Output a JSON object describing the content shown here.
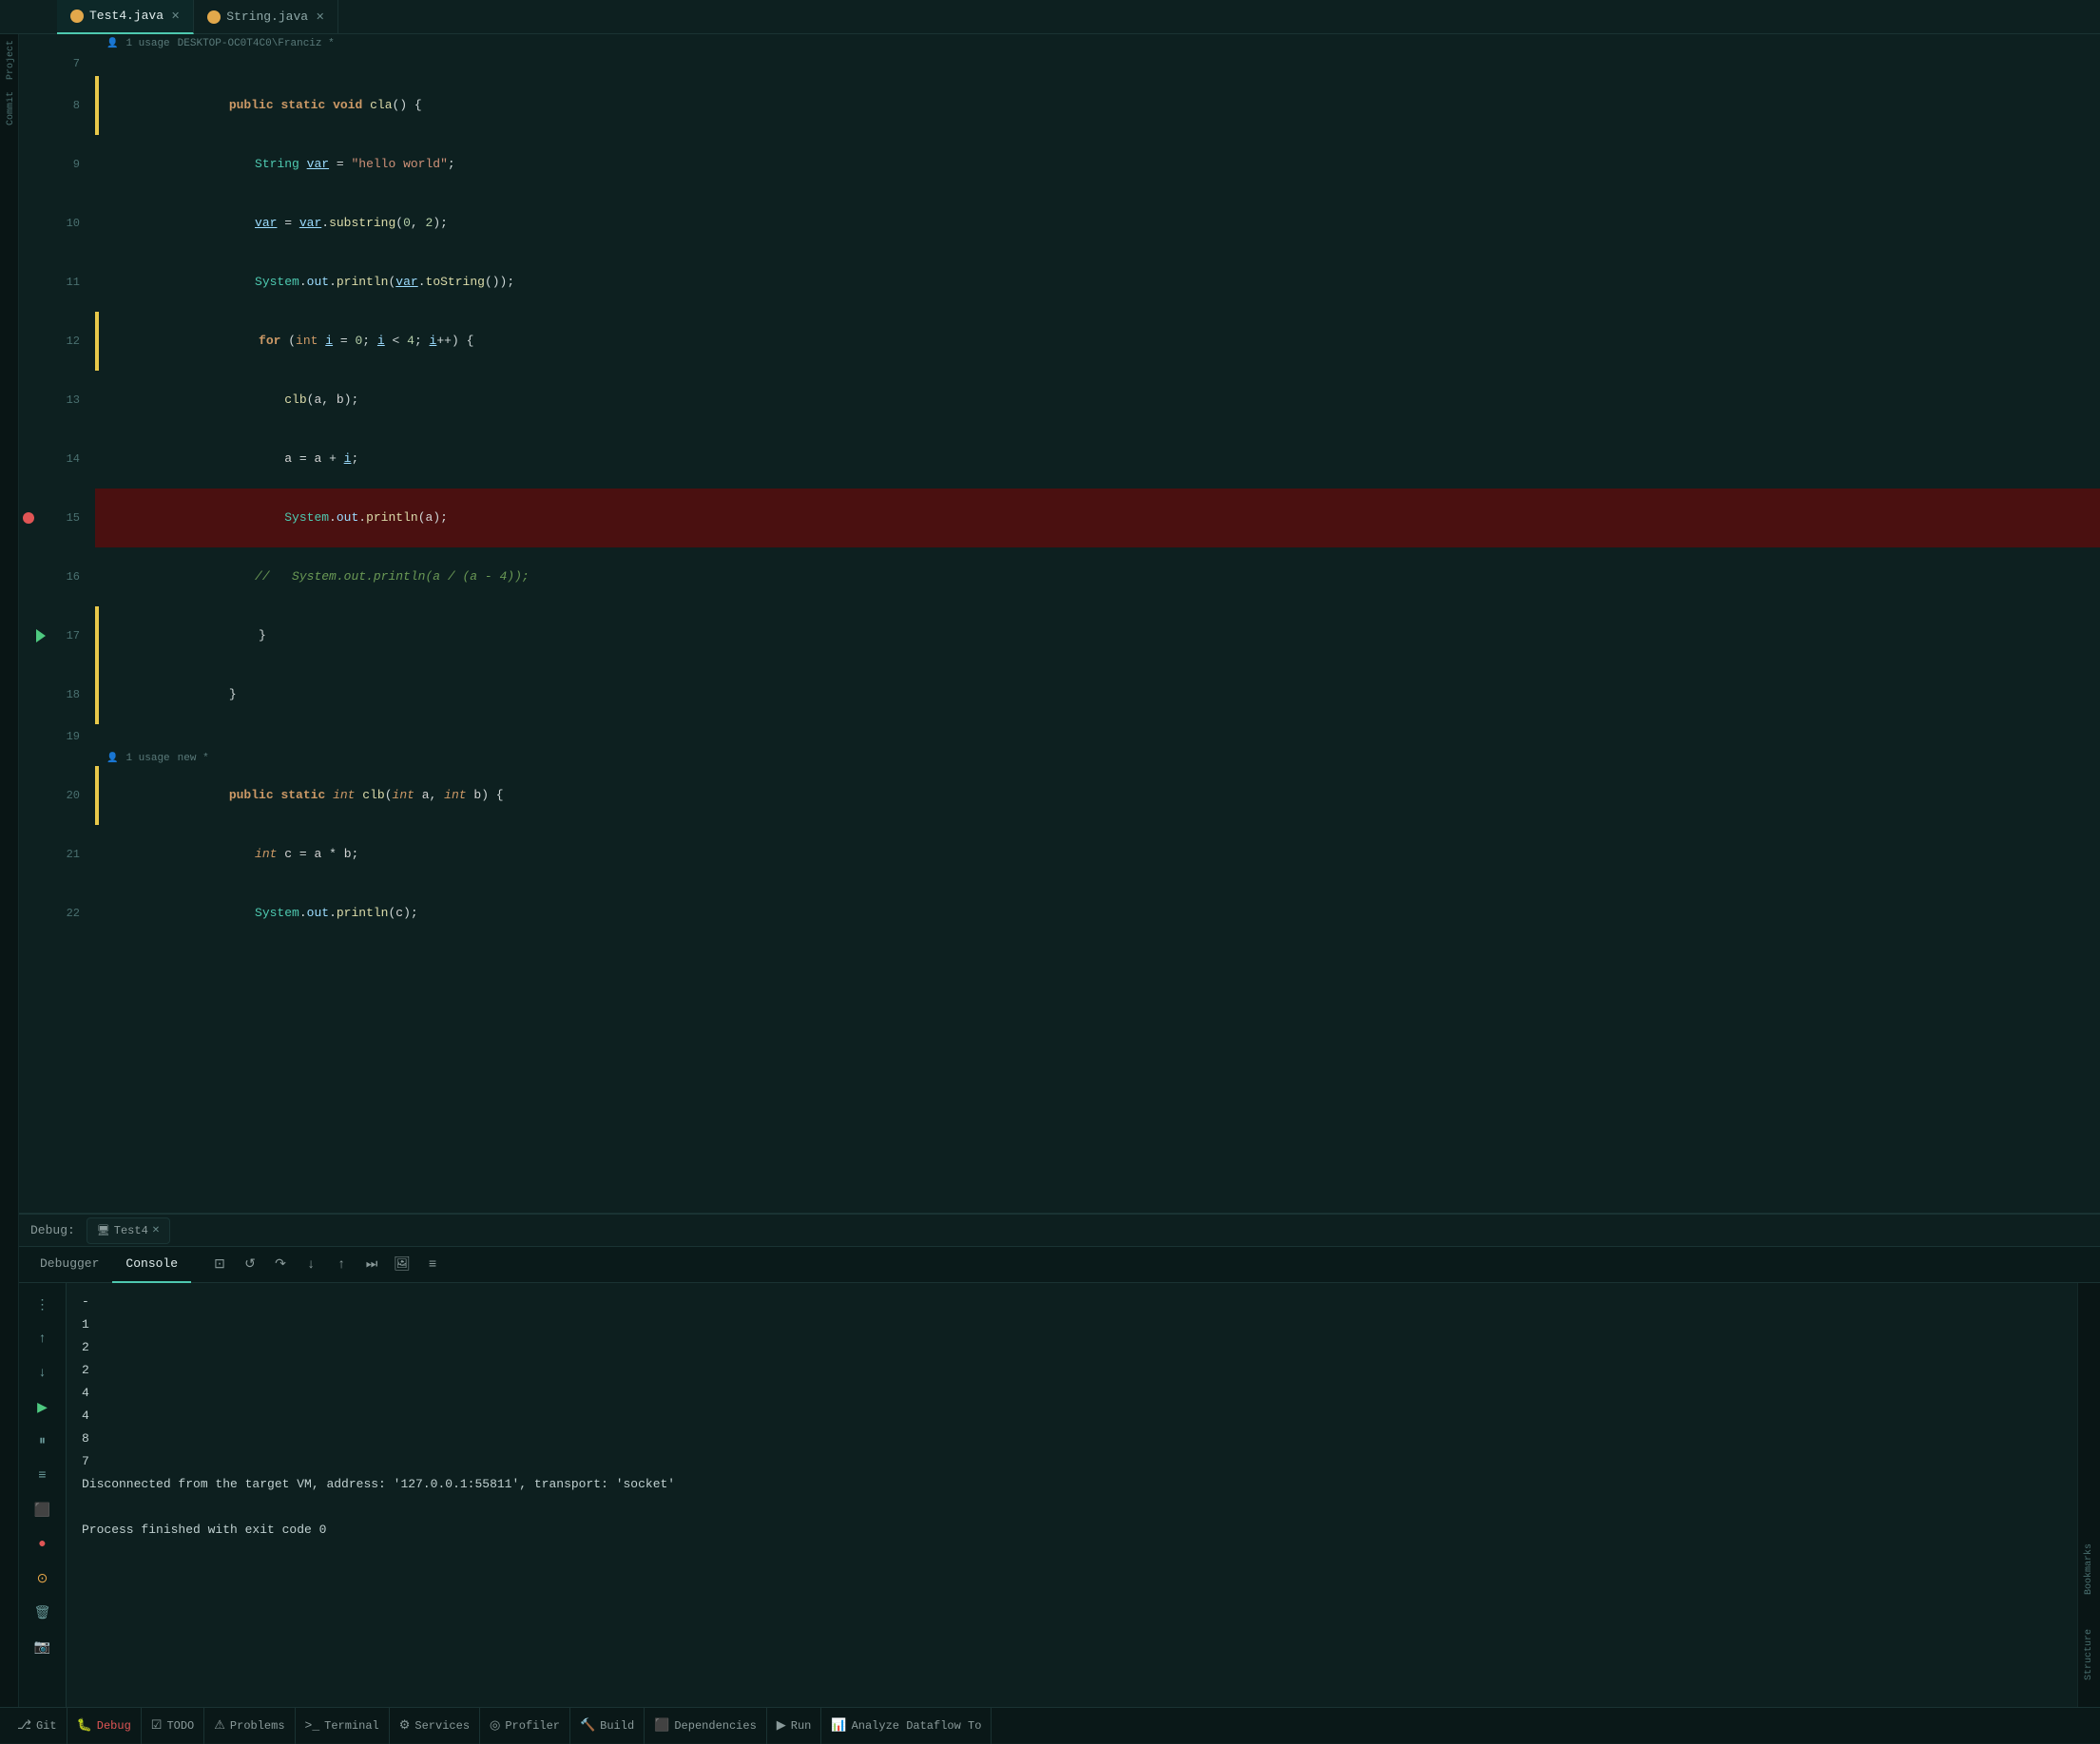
{
  "tabs": [
    {
      "id": "test4",
      "label": "Test4.java",
      "active": true,
      "modified": false
    },
    {
      "id": "string",
      "label": "String.java",
      "active": false,
      "modified": false
    }
  ],
  "editor": {
    "usage_hint_1": "1 usage",
    "usage_user_1": "DESKTOP-OC0T4C0\\Franciz *",
    "usage_hint_2": "1 usage",
    "usage_user_2": "new *",
    "lines": [
      {
        "num": "7",
        "text": "",
        "bar": false,
        "breakpoint": false,
        "debugArrow": false,
        "highlighted": false
      },
      {
        "num": "8",
        "text": "    public static void cla() {",
        "bar": true,
        "breakpoint": false,
        "debugArrow": false,
        "highlighted": false
      },
      {
        "num": "9",
        "text": "        String var = \"hello world\";",
        "bar": false,
        "breakpoint": false,
        "debugArrow": false,
        "highlighted": false
      },
      {
        "num": "10",
        "text": "        var = var.substring(0, 2);",
        "bar": false,
        "breakpoint": false,
        "debugArrow": false,
        "highlighted": false
      },
      {
        "num": "11",
        "text": "        System.out.println(var.toString());",
        "bar": false,
        "breakpoint": false,
        "debugArrow": false,
        "highlighted": false
      },
      {
        "num": "12",
        "text": "        for (int i = 0; i < 4; i++) {",
        "bar": true,
        "breakpoint": false,
        "debugArrow": false,
        "highlighted": false
      },
      {
        "num": "13",
        "text": "            clb(a, b);",
        "bar": false,
        "breakpoint": false,
        "debugArrow": false,
        "highlighted": false
      },
      {
        "num": "14",
        "text": "            a = a + i;",
        "bar": false,
        "breakpoint": false,
        "debugArrow": false,
        "highlighted": false
      },
      {
        "num": "15",
        "text": "            System.out.println(a);",
        "bar": false,
        "breakpoint": true,
        "debugArrow": false,
        "highlighted": true
      },
      {
        "num": "16",
        "text": "        //  System.out.println(a / (a - 4));",
        "bar": false,
        "breakpoint": false,
        "debugArrow": false,
        "highlighted": false
      },
      {
        "num": "17",
        "text": "        }",
        "bar": true,
        "breakpoint": false,
        "debugArrow": true,
        "highlighted": false
      },
      {
        "num": "18",
        "text": "    }",
        "bar": true,
        "breakpoint": false,
        "debugArrow": false,
        "highlighted": false
      },
      {
        "num": "19",
        "text": "",
        "bar": false,
        "breakpoint": false,
        "debugArrow": false,
        "highlighted": false
      },
      {
        "num": "20",
        "text": "    public static int clb(int a, int b) {",
        "bar": true,
        "breakpoint": false,
        "debugArrow": false,
        "highlighted": false
      },
      {
        "num": "21",
        "text": "        int c = a * b;",
        "bar": false,
        "breakpoint": false,
        "debugArrow": false,
        "highlighted": false
      },
      {
        "num": "22",
        "text": "        System.out.println(c);",
        "bar": false,
        "breakpoint": false,
        "debugArrow": false,
        "highlighted": false
      }
    ]
  },
  "debug": {
    "label": "Debug:",
    "session_tab": "Test4",
    "tabs": [
      {
        "id": "debugger",
        "label": "Debugger",
        "active": false
      },
      {
        "id": "console",
        "label": "Console",
        "active": true
      }
    ],
    "toolbar": [
      {
        "id": "screen",
        "icon": "⊡",
        "tooltip": "Screen"
      },
      {
        "id": "resume",
        "icon": "↺",
        "tooltip": "Resume"
      },
      {
        "id": "step-over",
        "icon": "↷",
        "tooltip": "Step Over"
      },
      {
        "id": "step-into",
        "icon": "↓",
        "tooltip": "Step Into"
      },
      {
        "id": "step-out",
        "icon": "↑",
        "tooltip": "Step Out"
      },
      {
        "id": "run-to-cursor",
        "icon": "⏭",
        "tooltip": "Run to Cursor"
      },
      {
        "id": "evaluate",
        "icon": "🖼",
        "tooltip": "Evaluate"
      },
      {
        "id": "frames",
        "icon": "≡",
        "tooltip": "Frames"
      }
    ],
    "console_output": [
      "-",
      "1",
      "2",
      "2",
      "4",
      "4",
      "8",
      "7",
      "Disconnected from the target VM, address: '127.0.0.1:55811', transport: 'socket'",
      "",
      "Process finished with exit code 0"
    ],
    "left_buttons": [
      {
        "id": "more",
        "icon": "⋮",
        "color": "plain"
      },
      {
        "id": "up",
        "icon": "↑",
        "color": "plain"
      },
      {
        "id": "down",
        "icon": "↓",
        "color": "plain"
      },
      {
        "id": "play",
        "icon": "▶",
        "color": "plain"
      },
      {
        "id": "pause",
        "icon": "⏸",
        "color": "plain"
      },
      {
        "id": "stack",
        "icon": "≡",
        "color": "plain"
      },
      {
        "id": "stop",
        "icon": "⬛",
        "color": "plain"
      },
      {
        "id": "breakpoint",
        "icon": "●",
        "color": "red"
      },
      {
        "id": "mute",
        "icon": "⊙",
        "color": "orange"
      },
      {
        "id": "trash",
        "icon": "🗑",
        "color": "plain"
      },
      {
        "id": "camera",
        "icon": "📷",
        "color": "plain"
      }
    ]
  },
  "statusbar": {
    "items": [
      {
        "id": "git",
        "icon": "⎇",
        "label": "Git"
      },
      {
        "id": "debug-active",
        "icon": "🐛",
        "label": "Debug",
        "active": true
      },
      {
        "id": "todo",
        "icon": "☑",
        "label": "TODO"
      },
      {
        "id": "problems",
        "icon": "⚠",
        "label": "Problems"
      },
      {
        "id": "terminal",
        "icon": ">_",
        "label": "Terminal"
      },
      {
        "id": "services",
        "icon": "⚙",
        "label": "Services"
      },
      {
        "id": "profiler",
        "icon": "◎",
        "label": "Profiler"
      },
      {
        "id": "build",
        "icon": "🔨",
        "label": "Build"
      },
      {
        "id": "dependencies",
        "icon": "⬛",
        "label": "Dependencies"
      },
      {
        "id": "run",
        "icon": "▶",
        "label": "Run"
      },
      {
        "id": "analyze",
        "icon": "📊",
        "label": "Analyze Dataflow To"
      }
    ]
  },
  "right_sidebar": {
    "labels": [
      "Bookmarks",
      "Structure"
    ]
  }
}
